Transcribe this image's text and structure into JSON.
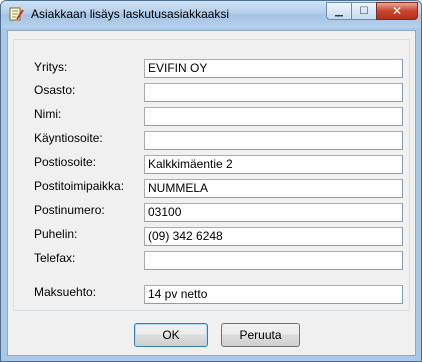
{
  "window": {
    "title": "Asiakkaan lisäys laskutusasiakkaaksi",
    "icon": "notepad-pen-icon"
  },
  "form": {
    "fields": [
      {
        "label": "Yritys:",
        "value": "EVIFIN OY"
      },
      {
        "label": "Osasto:",
        "value": ""
      },
      {
        "label": "Nimi:",
        "value": ""
      },
      {
        "label": "Käyntiosoite:",
        "value": ""
      },
      {
        "label": "Postiosoite:",
        "value": "Kalkkimäentie 2"
      },
      {
        "label": "Postitoimipaikka:",
        "value": "NUMMELA"
      },
      {
        "label": "Postinumero:",
        "value": "03100"
      },
      {
        "label": "Puhelin:",
        "value": "(09) 342 6248"
      },
      {
        "label": "Telefax:",
        "value": ""
      },
      {
        "label": "Maksuehto:",
        "value": "14 pv netto"
      }
    ]
  },
  "buttons": {
    "ok": "OK",
    "cancel": "Peruuta"
  }
}
